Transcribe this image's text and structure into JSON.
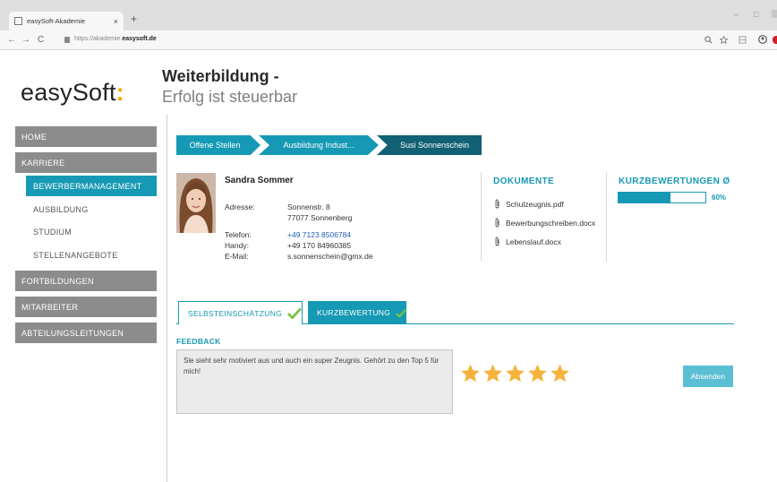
{
  "browser": {
    "tab_title": "easySoft-Akademie",
    "tab_close": "×",
    "new_tab": "+",
    "url_prefix": "https://akademie.",
    "url_domain": "easysoft.de",
    "nav_back": "←",
    "nav_forward": "→",
    "nav_reload": "C",
    "win_min": "–",
    "win_max": "□"
  },
  "header": {
    "logo": "easySoft",
    "logo_colon": ":",
    "title": "Weiterbildung -",
    "subtitle": "Erfolg ist steuerbar"
  },
  "sidebar": {
    "items": [
      {
        "label": "HOME"
      },
      {
        "label": "KARRIERE"
      },
      {
        "label": "BEWERBERMANAGEMENT"
      },
      {
        "label": "AUSBILDUNG"
      },
      {
        "label": "STUDIUM"
      },
      {
        "label": "STELLENANGEBOTE"
      },
      {
        "label": "FORTBILDUNGEN"
      },
      {
        "label": "MITARBEITER"
      },
      {
        "label": "ABTEILUNGSLEITUNGEN"
      }
    ]
  },
  "breadcrumb": [
    "Offene Stellen",
    "Ausbildung Indust...",
    "Susi Sonnenschein"
  ],
  "candidate": {
    "name": "Sandra Sommer",
    "address_label": "Adresse:",
    "address_line1": "Sonnenstr. 8",
    "address_line2": "77077 Sonnenberg",
    "phone_label": "Telefon:",
    "phone": "+49 7123 8506784",
    "mobile_label": "Handy:",
    "mobile": "+49 170 84960385",
    "email_label": "E-Mail:",
    "email": "s.sonnenschein@gmx.de"
  },
  "documents": {
    "heading": "DOKUMENTE",
    "files": [
      "Schulzeugnis.pdf",
      "Bewerbungschreiben.docx",
      "Lebenslauf.docx"
    ]
  },
  "short_ratings": {
    "heading": "KURZBEWERTUNGEN Ø",
    "progress_percent": 60,
    "progress_label": "60%"
  },
  "tabs": [
    {
      "label": "SELBSTEINSCHÄTZUNG"
    },
    {
      "label": "KURZBEWERTUNG"
    }
  ],
  "feedback": {
    "heading": "FEEDBACK",
    "text": "Sie sieht sehr motiviert aus und auch ein super Zeugnis. Gehört zu den Top 5 für mich!",
    "rating": 5,
    "rating_max": 5,
    "submit_label": "Absenden"
  },
  "colors": {
    "accent": "#1699b4",
    "accent_dark": "#126073",
    "nav_gray": "#8c8c8c",
    "star": "#f6b23c",
    "check": "#7dc242",
    "logo_colon": "#f5a100"
  }
}
